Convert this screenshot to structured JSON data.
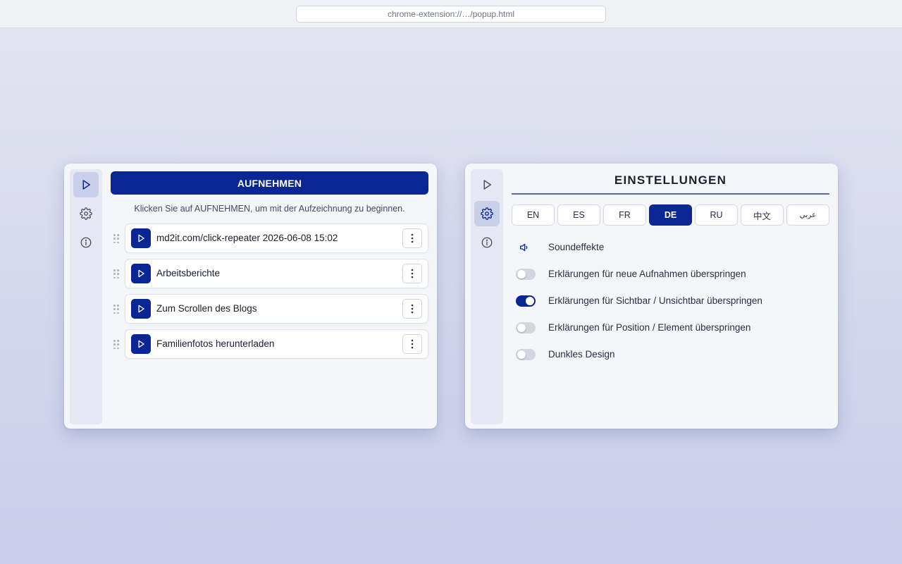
{
  "browser": {
    "url": "chrome-extension://…/popup.html"
  },
  "record_panel": {
    "record_button": "AUFNEHMEN",
    "hint": "Klicken Sie auf AUFNEHMEN, um mit der Aufzeichnung zu beginnen.",
    "recordings": [
      {
        "name": "md2it.com/click-repeater 2026-06-08 15:02"
      },
      {
        "name": "Arbeitsberichte"
      },
      {
        "name": "Zum Scrollen des Blogs"
      },
      {
        "name": "Familienfotos herunterladen"
      }
    ]
  },
  "nav": {
    "items": [
      {
        "icon": "play-icon"
      },
      {
        "icon": "gear-icon"
      },
      {
        "icon": "info-icon"
      }
    ]
  },
  "settings_panel": {
    "title": "EINSTELLUNGEN",
    "languages": [
      "EN",
      "ES",
      "FR",
      "DE",
      "RU",
      "中文",
      "عربي"
    ],
    "active_language": "DE",
    "settings": [
      {
        "label": "Soundeffekte",
        "type": "icon",
        "icon": "speaker-icon"
      },
      {
        "label": "Erklärungen für neue Aufnahmen überspringen",
        "type": "toggle",
        "on": false
      },
      {
        "label": "Erklärungen für Sichtbar / Unsichtbar überspringen",
        "type": "toggle",
        "on": true
      },
      {
        "label": "Erklärungen für Position / Element überspringen",
        "type": "toggle",
        "on": false
      },
      {
        "label": "Dunkles Design",
        "type": "toggle",
        "on": false
      }
    ]
  },
  "colors": {
    "primary": "#0a2694",
    "nav_active": "#c9cfe8",
    "background": "#c9cde8"
  }
}
